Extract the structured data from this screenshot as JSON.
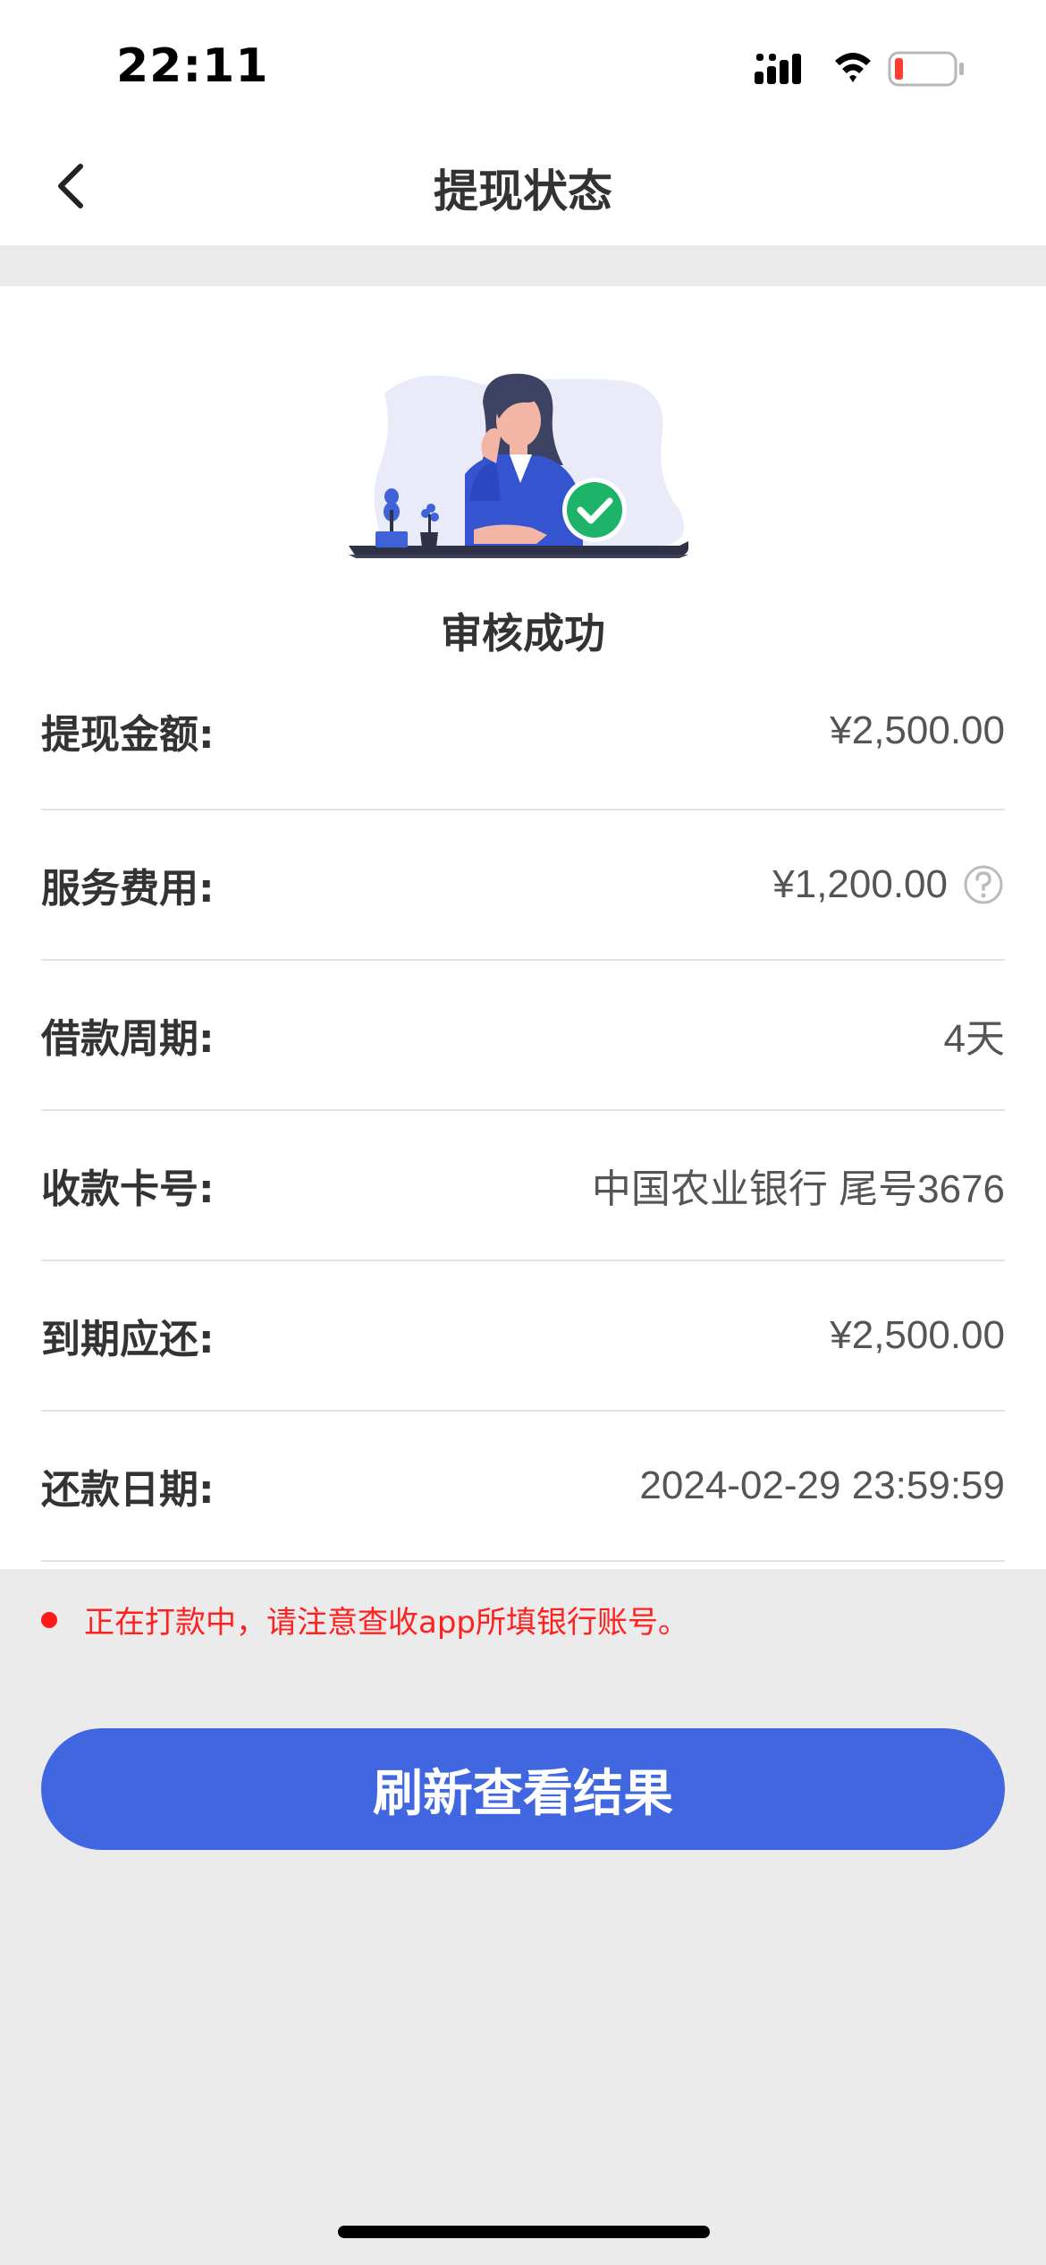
{
  "status_bar": {
    "time": "22:11",
    "icons": [
      "signal-icon",
      "wifi-icon",
      "battery-icon"
    ],
    "battery_level": 0.1
  },
  "nav": {
    "back_icon": "chevron-left-icon",
    "title": "提现状态"
  },
  "result": {
    "illustration": "woman-at-desk-success-illustration",
    "status_label": "审核成功"
  },
  "details": [
    {
      "label": "提现金额:",
      "value": "¥2,500.00"
    },
    {
      "label": "服务费用:",
      "value": "¥1,200.00",
      "icon": "question-mark-icon"
    },
    {
      "label": "借款周期:",
      "value": "4天"
    },
    {
      "label": "收款卡号:",
      "value": "中国农业银行 尾号3676"
    },
    {
      "label": "到期应还:",
      "value": "¥2,500.00"
    },
    {
      "label": "还款日期:",
      "value": "2024-02-29 23:59:59"
    }
  ],
  "notice": {
    "text": "正在打款中，请注意查收app所填银行账号。",
    "color": "#ff2020"
  },
  "refresh_button": {
    "label": "刷新查看结果",
    "color": "#4066e0"
  }
}
